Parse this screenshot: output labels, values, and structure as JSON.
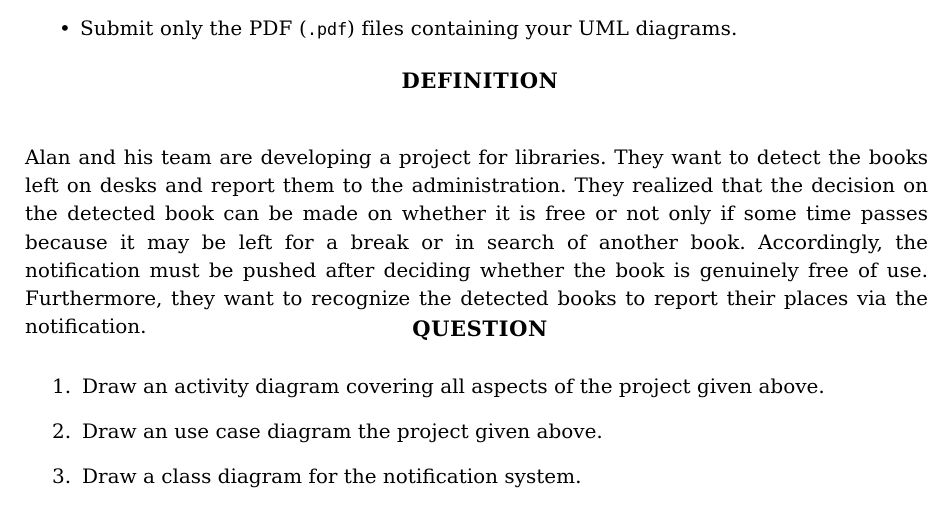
{
  "document": {
    "background_color": "#ffffff",
    "text_color": "#000000",
    "submission_note": {
      "bullet_glyph": "•",
      "text_before": "Submit only the PDF (",
      "code_text": ".pdf",
      "text_after": ") files containing your UML diagrams."
    },
    "sections": [
      {
        "heading": "DEFINITION",
        "paragraph": "Alan and his team are developing a project for libraries. They want to detect the books left on desks and report them to the administration. They realized that the decision on the detected book can be made on whether it is free or not only if some time passes because it may be left for a break or in search of another book. Accordingly, the notification must be pushed after deciding whether the book is genuinely free of use. Furthermore, they want to recognize the detected books to report their places via the notification."
      },
      {
        "heading": "QUESTION",
        "items": [
          {
            "marker": "1.",
            "text": "Draw an activity diagram covering all aspects of the project given above."
          },
          {
            "marker": "2.",
            "text": "Draw an use case diagram the project given above."
          },
          {
            "marker": "3.",
            "text": "Draw a class diagram for the notification system."
          }
        ]
      }
    ]
  }
}
